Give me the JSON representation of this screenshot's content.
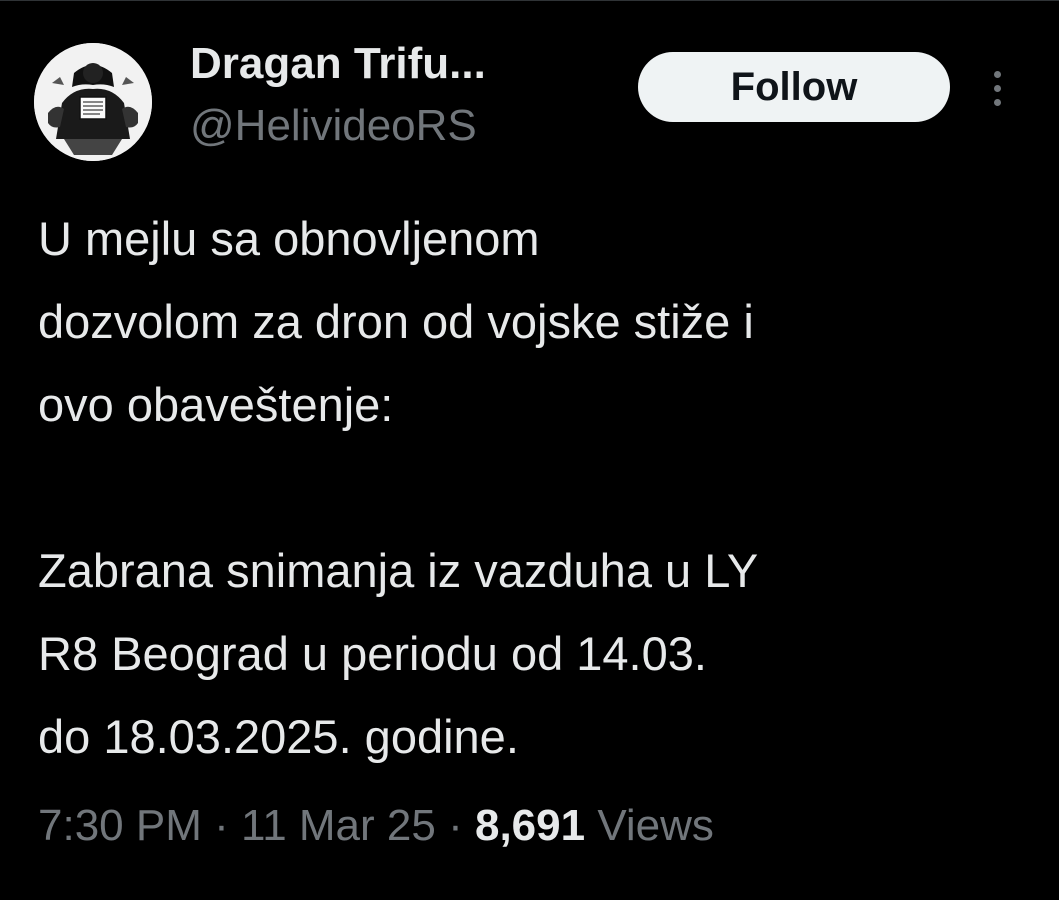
{
  "author": {
    "display_name": "Dragan Trifu...",
    "handle": "@HelivideoRS",
    "avatar_icon": "avatar-illustration"
  },
  "actions": {
    "follow_label": "Follow",
    "more_icon": "more-vertical-icon"
  },
  "tweet": {
    "lines": [
      "U mejlu sa obnovljenom",
      "dozvolom za dron od vojske stiže i",
      "ovo obaveštenje:",
      "",
      "Zabrana snimanja iz vazduha u LY",
      "R8 Beograd u periodu od 14.03.",
      "do 18.03.2025. godine."
    ]
  },
  "meta": {
    "time": "7:30 PM",
    "separator": "·",
    "date": "11 Mar 25",
    "views_count": "8,691",
    "views_label": "Views"
  },
  "colors": {
    "background": "#000000",
    "primary_text": "#e7e9ea",
    "secondary_text": "#71767b",
    "follow_bg": "#eff3f4",
    "follow_text": "#0f1419"
  }
}
